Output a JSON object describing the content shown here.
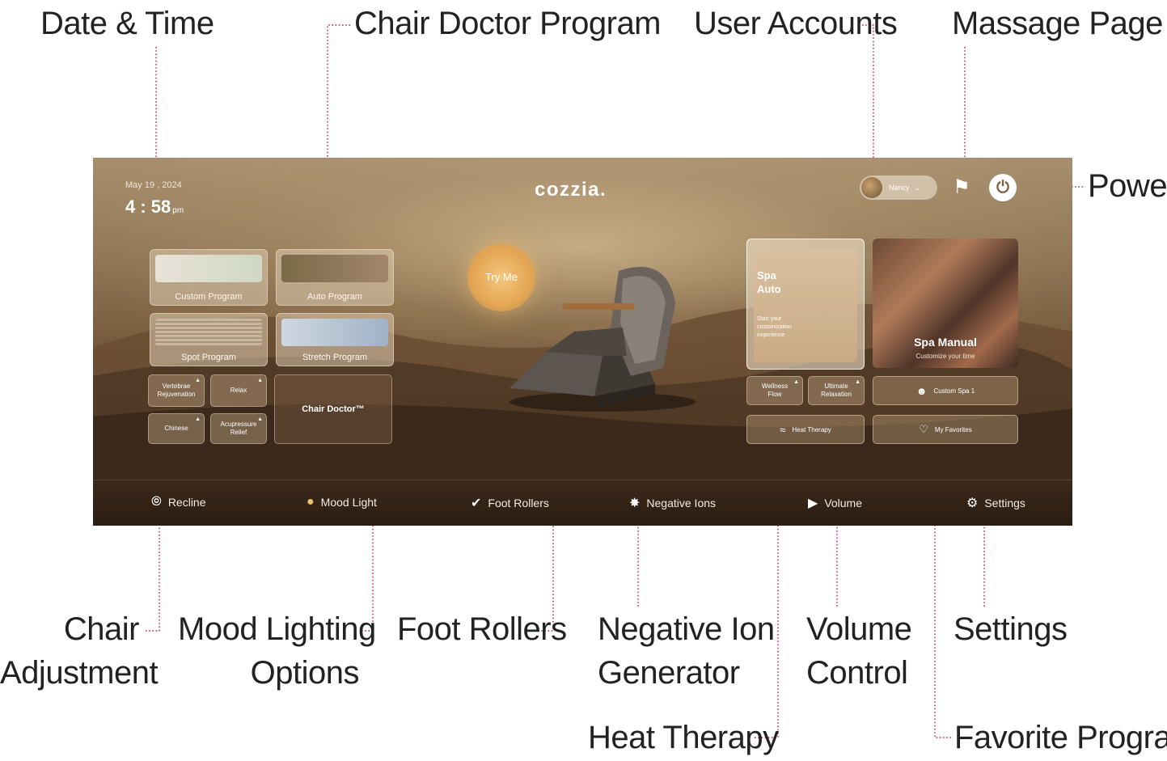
{
  "callouts": {
    "date_time": "Date & Time",
    "chair_doctor_program": "Chair Doctor Program",
    "user_accounts": "User Accounts",
    "massage_page": "Massage Page",
    "power": "Power",
    "chair_adjustment": [
      "Chair",
      "Adjustment"
    ],
    "mood_lighting": [
      "Mood Lighting",
      "Options"
    ],
    "foot_rollers": "Foot Rollers",
    "negative_ion": [
      "Negative Ion",
      "Generator"
    ],
    "volume_control": [
      "Volume",
      "Control"
    ],
    "settings": "Settings",
    "heat_therapy": "Heat Therapy",
    "favorite_programs": "Favorite Programs"
  },
  "screen": {
    "date": "May 19 , 2024",
    "time": "4 : 58",
    "ampm": "pm",
    "logo": "cozzia.",
    "user": {
      "name": "Nancy",
      "chevron": "⌄"
    },
    "try_me": "Try Me",
    "programs": {
      "custom": "Custom Program",
      "auto": "Auto Program",
      "spot": "Spot Program",
      "stretch": "Stretch Program",
      "vertebrae": [
        "Vertebrae",
        "Rejuvenation"
      ],
      "relax": "Relax",
      "chinese": "Chinese",
      "acupressure": [
        "Acupressure",
        "Relief"
      ],
      "chair_doctor": "Chair Doctor™"
    },
    "spa": {
      "auto_title": [
        "Spa",
        "Auto"
      ],
      "auto_desc": [
        "Start your",
        "customization",
        "experience"
      ],
      "manual_title": "Spa Manual",
      "manual_desc": "Customize your time",
      "wellness": [
        "Wellness",
        "Flow"
      ],
      "ultimate": [
        "Ultimate",
        "Relaxation"
      ],
      "custom_spa": "Custom Spa 1",
      "heat": "Heat Therapy",
      "favorites": "My Favorites"
    },
    "nav": {
      "recline": "Recline",
      "mood": "Mood Light",
      "foot": "Foot Rollers",
      "ions": "Negative Ions",
      "volume": "Volume",
      "settings": "Settings"
    }
  },
  "icons": {
    "massage": "massage-chair-icon",
    "power": "power-icon",
    "recline": "recline-icon",
    "mood": "bulb-icon",
    "foot": "foot-icon",
    "ions": "ion-icon",
    "volume": "speaker-icon",
    "settings": "gear-icon",
    "heat": "heat-waves-icon",
    "heart": "heart-icon",
    "person": "person-icon"
  },
  "colors": {
    "leader": "#b81f3f",
    "accent": "#e3a553"
  }
}
